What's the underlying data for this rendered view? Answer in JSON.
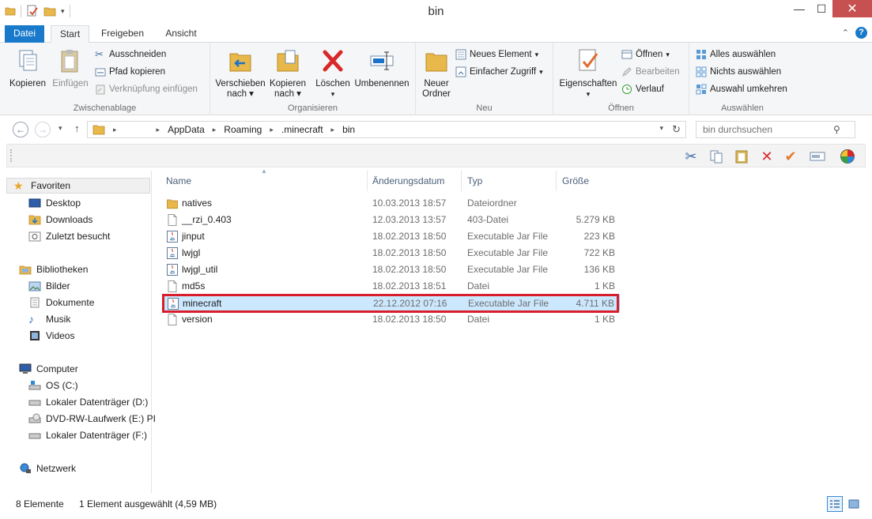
{
  "window": {
    "title": "bin",
    "minimize": "—",
    "maximize": "☐",
    "close": "✕"
  },
  "ribbon_tabs": [
    "Datei",
    "Start",
    "Freigeben",
    "Ansicht"
  ],
  "ribbon": {
    "clipboard": {
      "label": "Zwischenablage",
      "copy": "Kopieren",
      "paste": "Einfügen",
      "cut": "Ausschneiden",
      "copy_path": "Pfad kopieren",
      "paste_shortcut": "Verknüpfung einfügen"
    },
    "organize": {
      "label": "Organisieren",
      "move_to_1": "Verschieben",
      "move_to_2": "nach",
      "copy_to_1": "Kopieren",
      "copy_to_2": "nach",
      "delete": "Löschen",
      "rename": "Umbenennen"
    },
    "new": {
      "label": "Neu",
      "new_folder_1": "Neuer",
      "new_folder_2": "Ordner",
      "new_item": "Neues Element",
      "easy_access": "Einfacher Zugriff"
    },
    "open": {
      "label": "Öffnen",
      "properties": "Eigenschaften",
      "open": "Öffnen",
      "edit": "Bearbeiten",
      "history": "Verlauf"
    },
    "select": {
      "label": "Auswählen",
      "select_all": "Alles auswählen",
      "select_none": "Nichts auswählen",
      "invert": "Auswahl umkehren"
    }
  },
  "address": {
    "crumbs": [
      "AppData",
      "Roaming",
      ".minecraft",
      "bin"
    ],
    "search_placeholder": "bin durchsuchen"
  },
  "nav": {
    "favorites": "Favoriten",
    "desktop": "Desktop",
    "downloads": "Downloads",
    "recent": "Zuletzt besucht",
    "libraries": "Bibliotheken",
    "pictures": "Bilder",
    "documents": "Dokumente",
    "music": "Musik",
    "videos": "Videos",
    "computer": "Computer",
    "drive_c": "OS (C:)",
    "drive_d": "Lokaler Datenträger (D:)",
    "drive_e": "DVD-RW-Laufwerk (E:) PI",
    "drive_f": "Lokaler Datenträger (F:)",
    "network": "Netzwerk"
  },
  "columns": [
    "Name",
    "Änderungsdatum",
    "Typ",
    "Größe"
  ],
  "files": [
    {
      "name": "natives",
      "date": "10.03.2013 18:57",
      "type": "Dateiordner",
      "size": "",
      "icon": "folder"
    },
    {
      "name": "__rzi_0.403",
      "date": "12.03.2013 13:57",
      "type": "403-Datei",
      "size": "5.279 KB",
      "icon": "file"
    },
    {
      "name": "jinput",
      "date": "18.02.2013 18:50",
      "type": "Executable Jar File",
      "size": "223 KB",
      "icon": "jar"
    },
    {
      "name": "lwjgl",
      "date": "18.02.2013 18:50",
      "type": "Executable Jar File",
      "size": "722 KB",
      "icon": "jar"
    },
    {
      "name": "lwjgl_util",
      "date": "18.02.2013 18:50",
      "type": "Executable Jar File",
      "size": "136 KB",
      "icon": "jar"
    },
    {
      "name": "md5s",
      "date": "18.02.2013 18:51",
      "type": "Datei",
      "size": "1 KB",
      "icon": "file"
    },
    {
      "name": "minecraft",
      "date": "22.12.2012 07:16",
      "type": "Executable Jar File",
      "size": "4.711 KB",
      "icon": "jar"
    },
    {
      "name": "version",
      "date": "18.02.2013 18:50",
      "type": "Datei",
      "size": "1 KB",
      "icon": "file"
    }
  ],
  "status": {
    "count": "8 Elemente",
    "selection": "1 Element ausgewählt (4,59 MB)"
  },
  "colors": {
    "accent": "#1979ca",
    "selection_bg": "#cce8ff",
    "highlight_border": "#d81e2a",
    "folder": "#e8b84a"
  }
}
